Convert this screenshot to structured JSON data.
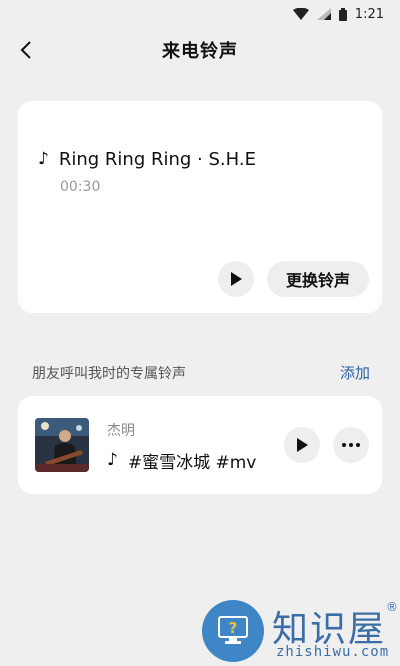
{
  "status_bar": {
    "time": "1:21"
  },
  "header": {
    "title": "来电铃声"
  },
  "current_ringtone": {
    "song": "Ring Ring Ring · S.H.E",
    "duration": "00:30",
    "change_label": "更换铃声"
  },
  "friends_section": {
    "title": "朋友呼叫我时的专属铃声",
    "add_label": "添加",
    "items": [
      {
        "name": "杰明",
        "song": "#蜜雪冰城 #mv"
      }
    ]
  },
  "watermark": {
    "brand": "知识屋",
    "reg": "®",
    "site": "zhishiwu.com"
  },
  "icons": {
    "back": "chevron-left-icon",
    "note": "music-note-icon",
    "play": "play-icon",
    "more": "more-horizontal-icon"
  },
  "colors": {
    "accent_link": "#2d5fa6",
    "background": "#efefef",
    "card": "#ffffff"
  }
}
